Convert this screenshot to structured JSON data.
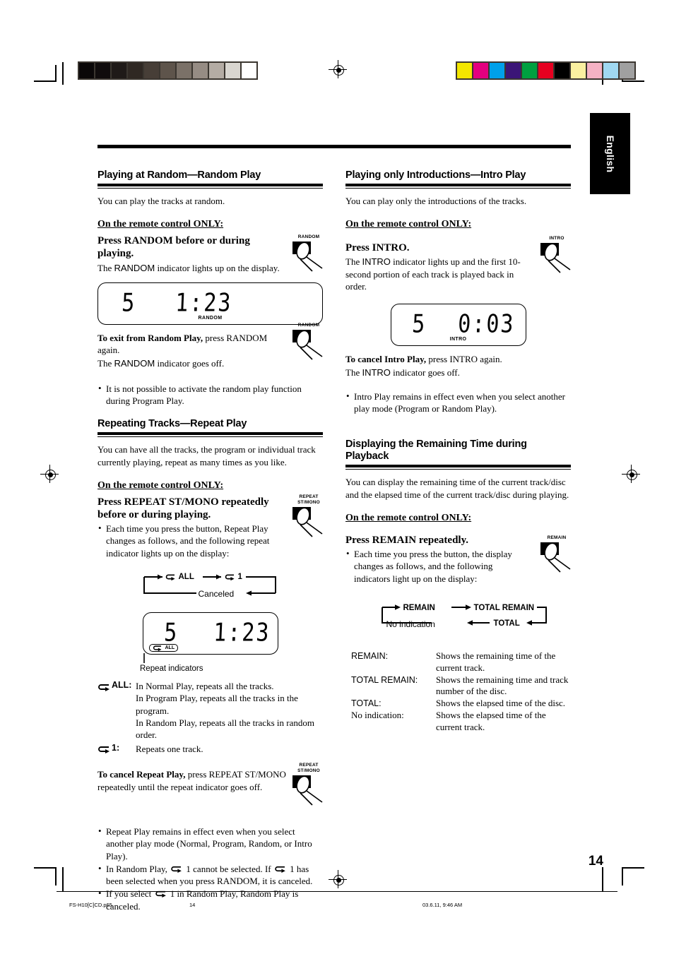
{
  "page": {
    "language_tab": "English",
    "page_number": "14",
    "footer": {
      "file": "FS-H10[C]CD.p65",
      "page": "14",
      "timestamp": "03.6.11, 9:46 AM"
    }
  },
  "calibration": {
    "gray_bar": [
      "#0a0708",
      "#100c0d",
      "#1f1a18",
      "#2f2823",
      "#473e37",
      "#5e544b",
      "#7b7168",
      "#968c84",
      "#b4aca4",
      "#d9d6d0",
      "#ffffff"
    ],
    "color_bar": [
      "#f3e600",
      "#e4007f",
      "#00a0e9",
      "#3b1577",
      "#00a040",
      "#e60020",
      "#000000",
      "#faf0a0",
      "#f5b2c4",
      "#a0d8f1",
      "#a0a0a0"
    ]
  },
  "left_column": {
    "random": {
      "heading": "Playing at Random—Random Play",
      "lead": "You can play the tracks at random.",
      "remote_only": "On the remote control ONLY:",
      "press_title": "Press RANDOM before or during playing.",
      "press_note_a": "The ",
      "press_note_b": "RANDOM",
      "press_note_c": " indicator lights up on the display.",
      "key_label": "RANDOM",
      "display": {
        "track": "5",
        "time": "1:23",
        "indicator": "RANDOM"
      },
      "exit_bold": "To exit from Random Play,",
      "exit_rest": " press RANDOM again.",
      "exit_line2_a": "The ",
      "exit_line2_b": "RANDOM",
      "exit_line2_c": " indicator goes off.",
      "exit_key_label": "RANDOM",
      "bullets": [
        "It is not possible to activate the random play function during Program Play."
      ]
    },
    "repeat": {
      "heading": "Repeating Tracks—Repeat Play",
      "lead": "You can have all the tracks, the program or individual track currently playing, repeat as many times as you like.",
      "remote_only": "On the remote control ONLY:",
      "press_title": "Press REPEAT ST/MONO repeatedly before or during playing.",
      "key_label_line1": "REPEAT",
      "key_label_line2": "ST/MONO",
      "bullets": [
        "Each time you press the button, Repeat Play changes as follows, and the following repeat indicator lights up on the display:"
      ],
      "flow": {
        "node1": "ALL",
        "node2": "1",
        "node3": "Canceled"
      },
      "display": {
        "track": "5",
        "time": "1:23",
        "indicator": "ALL"
      },
      "display_caption": "Repeat indicators",
      "index": [
        {
          "label": "ALL:",
          "lines": [
            "In Normal Play, repeats all the tracks.",
            "In Program Play, repeats all the tracks in the program.",
            "In Random Play, repeats all the tracks in random order."
          ]
        },
        {
          "label": "1:",
          "lines": [
            "Repeats one track."
          ]
        }
      ],
      "cancel_bold": "To cancel Repeat Play,",
      "cancel_rest": " press REPEAT ST/MONO repeatedly until the repeat indicator goes off.",
      "cancel_key_line1": "REPEAT",
      "cancel_key_line2": "ST/MONO",
      "final_bullets": [
        "Repeat Play remains in effect even when you select another play mode (Normal, Program, Random, or Intro Play).",
        "In Random Play, ↺ 1 cannot be selected. If ↺ 1 has been selected when you press RANDOM, it is canceled.",
        "If you select ↺ 1 in Random Play, Random Play is canceled."
      ]
    }
  },
  "right_column": {
    "intro": {
      "heading": "Playing only Introductions—Intro Play",
      "lead": "You can play only the introductions of the tracks.",
      "remote_only": "On the remote control ONLY:",
      "press_title": "Press INTRO.",
      "press_note_a": "The ",
      "press_note_b": "INTRO",
      "press_note_c": " indicator lights up and the first 10-second portion of each track is played back in order.",
      "key_label": "INTRO",
      "display": {
        "track": "5",
        "time": "0:03",
        "indicator": "INTRO"
      },
      "cancel_bold": "To cancel Intro Play,",
      "cancel_rest": " press INTRO again.",
      "cancel_line2_a": "The ",
      "cancel_line2_b": "INTRO",
      "cancel_line2_c": " indicator goes off.",
      "bullets": [
        "Intro Play remains in effect even when you select another play mode (Program or Random Play)."
      ]
    },
    "remain": {
      "heading": "Displaying the Remaining Time during Playback",
      "lead": "You can display the remaining time of the current track/disc and the elapsed time of the current track/disc during playing.",
      "remote_only": "On the remote control ONLY:",
      "press_title": "Press REMAIN repeatedly.",
      "key_label": "REMAIN",
      "bullets": [
        "Each time you press the button, the display changes as follows, and the following indicators light up on the display:"
      ],
      "flow": {
        "node1": "REMAIN",
        "node2": "TOTAL REMAIN",
        "node3": "TOTAL",
        "node4": "No indication"
      },
      "definitions": [
        {
          "term": "REMAIN:",
          "serif": false,
          "desc": "Shows the remaining time of the current track."
        },
        {
          "term": "TOTAL REMAIN:",
          "serif": false,
          "desc": "Shows the remaining time and track number of the disc."
        },
        {
          "term": "TOTAL:",
          "serif": false,
          "desc": "Shows the elapsed time of the disc."
        },
        {
          "term": "No indication:",
          "serif": true,
          "desc": "Shows the elapsed time of the current track."
        }
      ]
    }
  }
}
